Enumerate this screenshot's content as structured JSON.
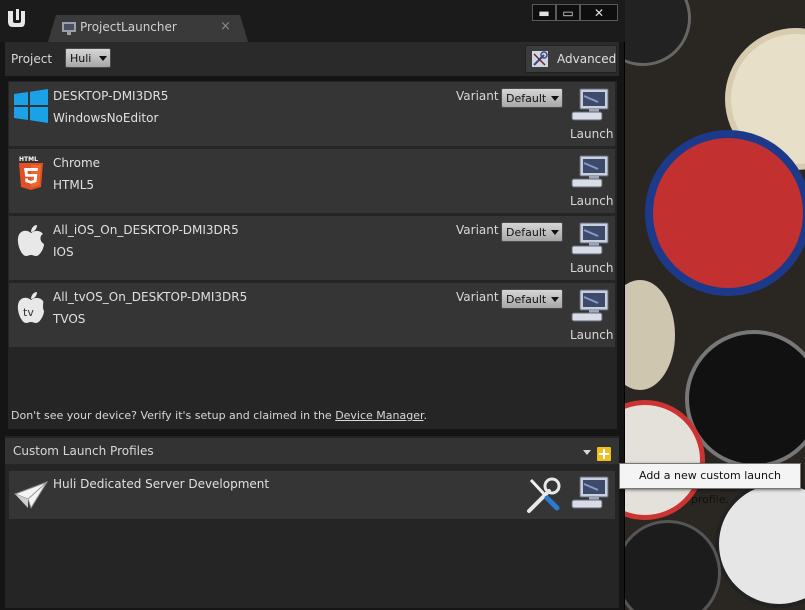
{
  "window": {
    "tab_title": "ProjectLauncher",
    "tab_close": "×",
    "minimize_glyph": "▬",
    "maximize_glyph": "▭",
    "close_glyph": "✕"
  },
  "toolbar": {
    "project_label": "Project",
    "project_value": "Huli",
    "advanced_label": "Advanced"
  },
  "devices": [
    {
      "name": "DESKTOP-DMI3DR5",
      "type": "WindowsNoEditor",
      "icon": "windows-icon",
      "has_variant": true,
      "variant_label": "Variant",
      "variant_value": "Default",
      "launch_label": "Launch"
    },
    {
      "name": "Chrome",
      "type": "HTML5",
      "icon": "html5-icon",
      "has_variant": false,
      "launch_label": "Launch"
    },
    {
      "name": "All_iOS_On_DESKTOP-DMI3DR5",
      "type": "IOS",
      "icon": "apple-icon",
      "has_variant": true,
      "variant_label": "Variant",
      "variant_value": "Default",
      "launch_label": "Launch"
    },
    {
      "name": "All_tvOS_On_DESKTOP-DMI3DR5",
      "type": "TVOS",
      "icon": "apple-tv-icon",
      "has_variant": true,
      "variant_label": "Variant",
      "variant_value": "Default",
      "launch_label": "Launch"
    }
  ],
  "hint": {
    "text": "Don't see your device? Verify it's setup and claimed in the ",
    "link": "Device Manager",
    "suffix": "."
  },
  "custom_profiles": {
    "title": "Custom Launch Profiles",
    "profiles": [
      {
        "name": "Huli Dedicated Server Development"
      }
    ]
  },
  "tooltip": {
    "text": "Add a new custom launch profile."
  },
  "colors": {
    "window_bg": "#151515",
    "panel_bg": "#353535",
    "add_button": "#f0c020",
    "windows_blue": "#1aa1e8",
    "html5_orange": "#e34f26"
  }
}
